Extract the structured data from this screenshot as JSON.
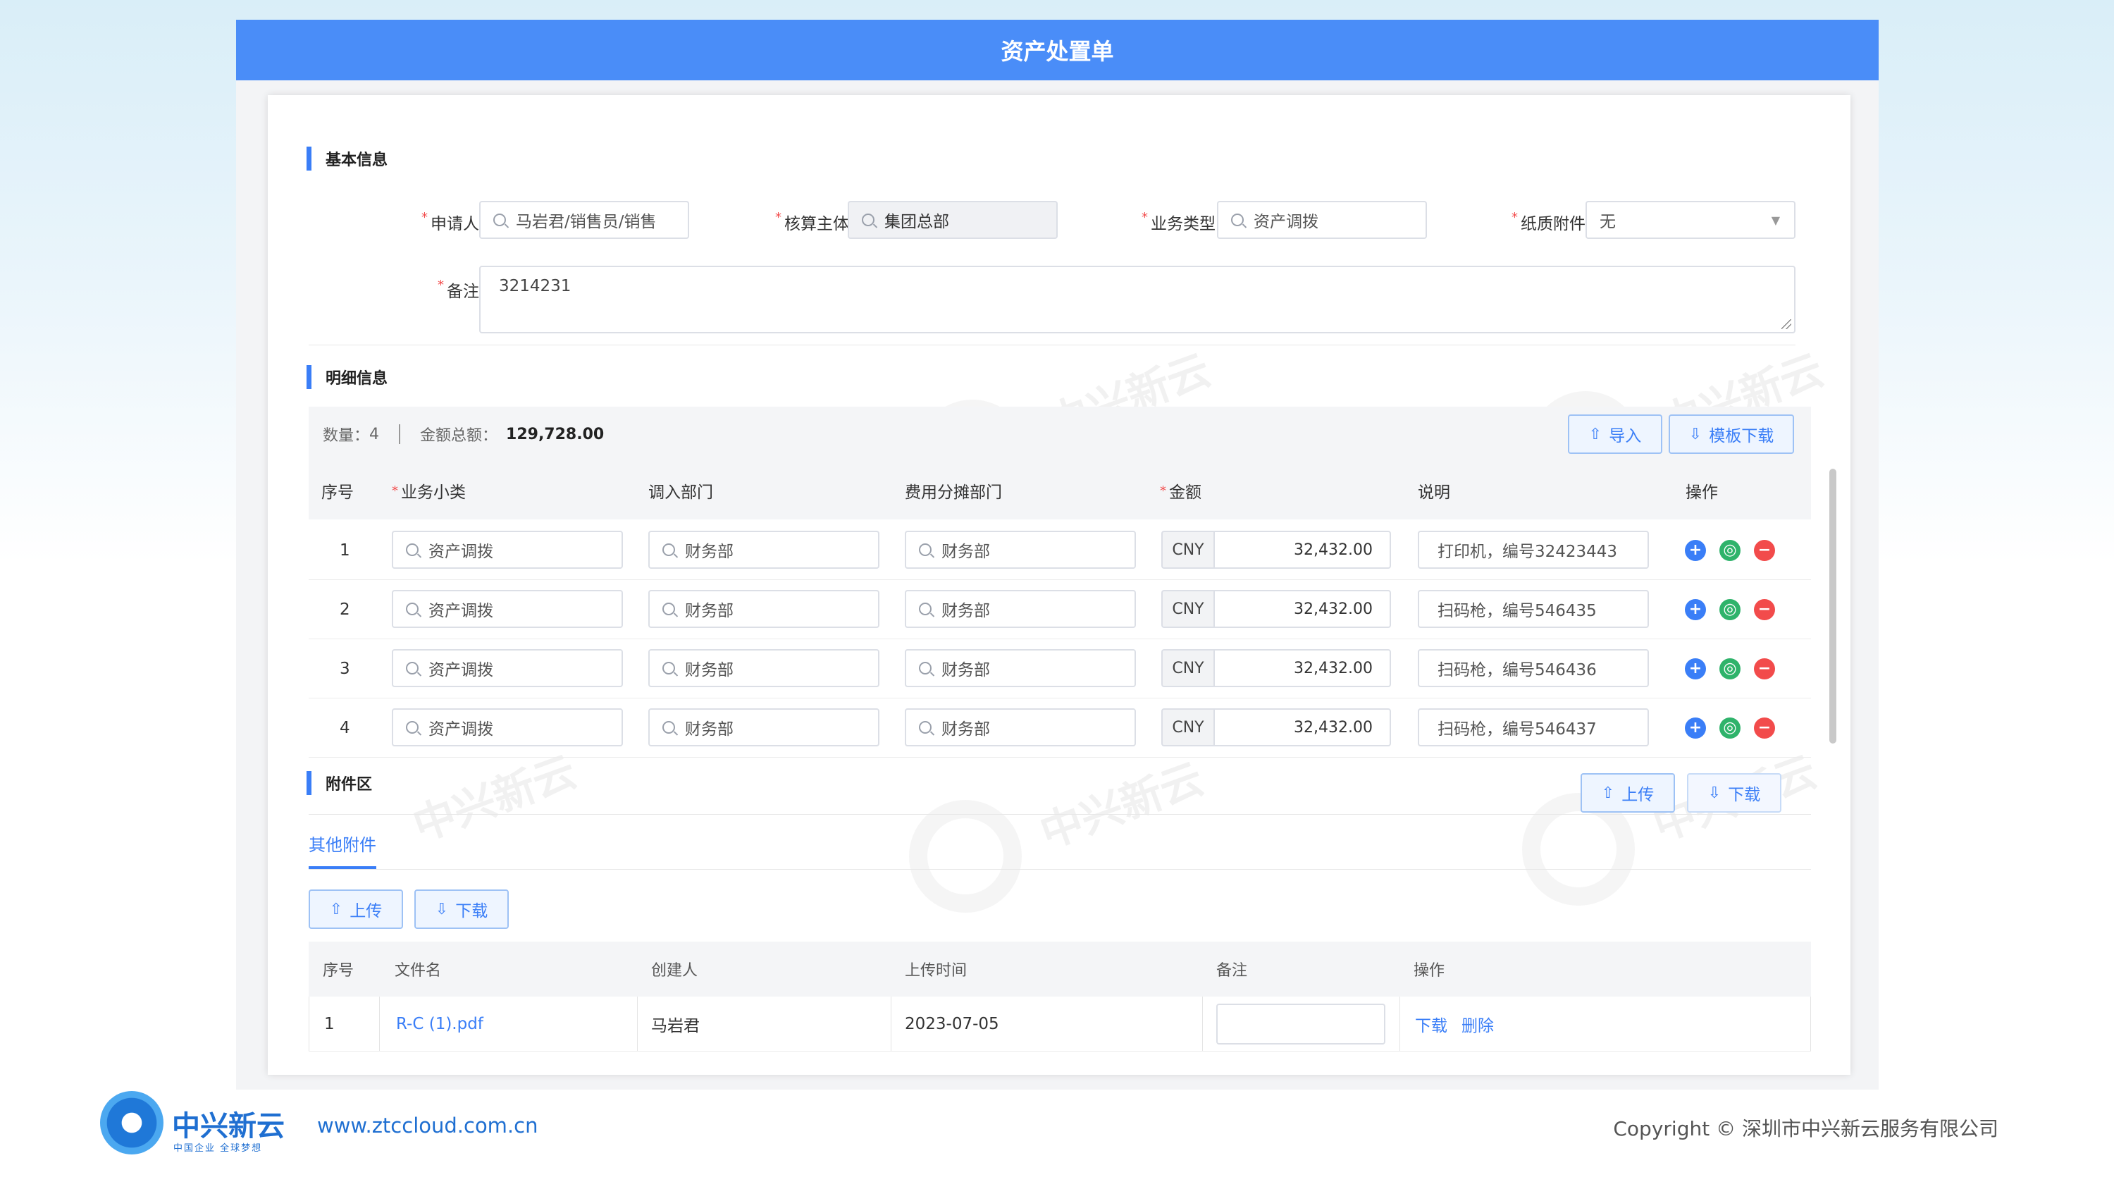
{
  "app": {
    "title": "资产处置单"
  },
  "basic": {
    "section_title": "基本信息",
    "applicant_label": "申请人",
    "applicant_value": "马岩君/销售员/销售",
    "entity_label": "核算主体",
    "entity_value": "集团总部",
    "biz_type_label": "业务类型",
    "biz_type_value": "资产调拨",
    "paper_label": "纸质附件",
    "paper_value": "无",
    "remark_label": "备注",
    "remark_value": "3214231"
  },
  "detail": {
    "section_title": "明细信息",
    "count_label": "数量：",
    "count_value": "4",
    "total_label": "金额总额：",
    "total_value": "129,728.00",
    "import_button": "导入",
    "template_button": "模板下载",
    "columns": {
      "seq": "序号",
      "subtype": "业务小类",
      "in_dept": "调入部门",
      "cost_dept": "费用分摊部门",
      "amount": "金额",
      "desc": "说明",
      "ops": "操作"
    },
    "rows": [
      {
        "seq": "1",
        "subtype": "资产调拨",
        "in_dept": "财务部",
        "cost_dept": "财务部",
        "currency": "CNY",
        "amount": "32,432.00",
        "desc": "打印机，编号32423443"
      },
      {
        "seq": "2",
        "subtype": "资产调拨",
        "in_dept": "财务部",
        "cost_dept": "财务部",
        "currency": "CNY",
        "amount": "32,432.00",
        "desc": "扫码枪，编号546435"
      },
      {
        "seq": "3",
        "subtype": "资产调拨",
        "in_dept": "财务部",
        "cost_dept": "财务部",
        "currency": "CNY",
        "amount": "32,432.00",
        "desc": "扫码枪，编号546436"
      },
      {
        "seq": "4",
        "subtype": "资产调拨",
        "in_dept": "财务部",
        "cost_dept": "财务部",
        "currency": "CNY",
        "amount": "32,432.00",
        "desc": "扫码枪，编号546437"
      }
    ]
  },
  "attach": {
    "section_title": "附件区",
    "upload_button": "上传",
    "download_button": "下载",
    "tab_label": "其他附件",
    "columns": {
      "seq": "序号",
      "filename": "文件名",
      "creator": "创建人",
      "upload_time": "上传时间",
      "remark": "备注",
      "ops": "操作"
    },
    "rows": [
      {
        "seq": "1",
        "filename": "R-C (1).pdf",
        "creator": "马岩君",
        "upload_time": "2023-07-05",
        "remark": "",
        "download": "下载",
        "delete": "删除"
      }
    ]
  },
  "watermark": {
    "text": "中兴新云"
  },
  "footer": {
    "brand": "中兴新云",
    "slogan": "中国企业 全球梦想",
    "url": "www.ztccloud.com.cn",
    "copyright": "Copyright © 深圳市中兴新云服务有限公司"
  }
}
